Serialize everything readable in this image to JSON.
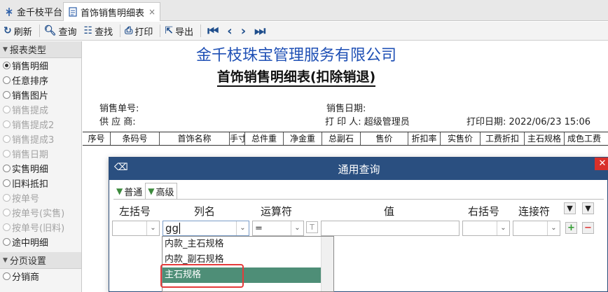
{
  "tabs": [
    {
      "label": "金千枝平台",
      "icon": "app-logo-icon"
    },
    {
      "label": "首饰销售明细表",
      "icon": "document-icon",
      "close": "×"
    }
  ],
  "toolbar": {
    "refresh": "刷新",
    "query": "查询",
    "find": "查找",
    "print": "打印",
    "export": "导出",
    "nav_icons": [
      "first-page-icon",
      "prev-page-icon",
      "next-page-icon",
      "last-page-icon"
    ]
  },
  "left_panel": {
    "section1_title": "报表类型",
    "options": [
      {
        "label": "销售明细",
        "selected": true,
        "enabled": true
      },
      {
        "label": "任意排序",
        "selected": false,
        "enabled": true
      },
      {
        "label": "销售图片",
        "selected": false,
        "enabled": true
      },
      {
        "label": "销售提成",
        "selected": false,
        "enabled": false
      },
      {
        "label": "销售提成2",
        "selected": false,
        "enabled": false
      },
      {
        "label": "销售提成3",
        "selected": false,
        "enabled": false
      },
      {
        "label": "销售日期",
        "selected": false,
        "enabled": false
      },
      {
        "label": "实售明细",
        "selected": false,
        "enabled": true
      },
      {
        "label": "旧料抵扣",
        "selected": false,
        "enabled": true
      },
      {
        "label": "按单号",
        "selected": false,
        "enabled": false
      },
      {
        "label": "按单号(实售)",
        "selected": false,
        "enabled": false
      },
      {
        "label": "按单号(旧料)",
        "selected": false,
        "enabled": false
      },
      {
        "label": "途中明细",
        "selected": false,
        "enabled": true
      }
    ],
    "section2_title": "分页设置",
    "section2_options": [
      {
        "label": "分销商",
        "selected": false,
        "enabled": true
      }
    ]
  },
  "report": {
    "company": "金千枝珠宝管理服务有限公司",
    "title": "首饰销售明细表(扣除销退)",
    "sale_no_label": "销售单号:",
    "supplier_label": "供 应 商:",
    "sale_date_label": "销售日期:",
    "printer_label": "打 印 人:",
    "printer_value": "超级管理员",
    "print_date_label": "打印日期:",
    "print_date_value": "2022/06/23 15:06",
    "columns": [
      "序号",
      "条码号",
      "首饰名称",
      "手寸",
      "总件重",
      "净金重",
      "总副石",
      "售价",
      "折扣率",
      "实售价",
      "工费折扣",
      "主石规格",
      "成色工费"
    ]
  },
  "dialog": {
    "title": "通用查询",
    "tabs": [
      "普通",
      "高级"
    ],
    "headers": {
      "left_paren": "左括号",
      "column": "列名",
      "operator": "运算符",
      "value": "值",
      "right_paren": "右括号",
      "connector": "连接符"
    },
    "column_input": "gg",
    "operator_value": "="
  },
  "dropdown": {
    "items": [
      "内款_主石规格",
      "内款_副石规格",
      "主石规格"
    ],
    "highlighted_index": 2
  }
}
